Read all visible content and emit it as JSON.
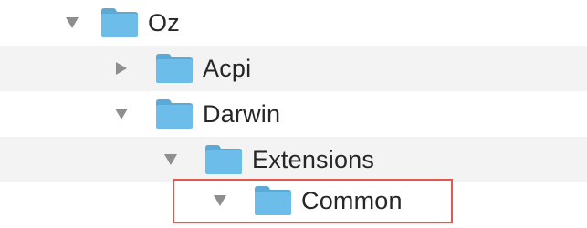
{
  "tree": {
    "items": [
      {
        "label": "Oz",
        "expanded": true,
        "icon": "folder-icon"
      },
      {
        "label": "Acpi",
        "expanded": false,
        "icon": "folder-icon"
      },
      {
        "label": "Darwin",
        "expanded": true,
        "icon": "folder-icon"
      },
      {
        "label": "Extensions",
        "expanded": true,
        "icon": "folder-icon"
      },
      {
        "label": "Common",
        "expanded": true,
        "icon": "folder-icon",
        "highlighted": true
      }
    ]
  },
  "colors": {
    "folder": "#6cbde9",
    "folder_tab": "#5aa9d6",
    "disclosure": "#8e8e8e",
    "stripe": "#f3f3f3",
    "highlight": "#e8574f",
    "text": "#262626"
  }
}
